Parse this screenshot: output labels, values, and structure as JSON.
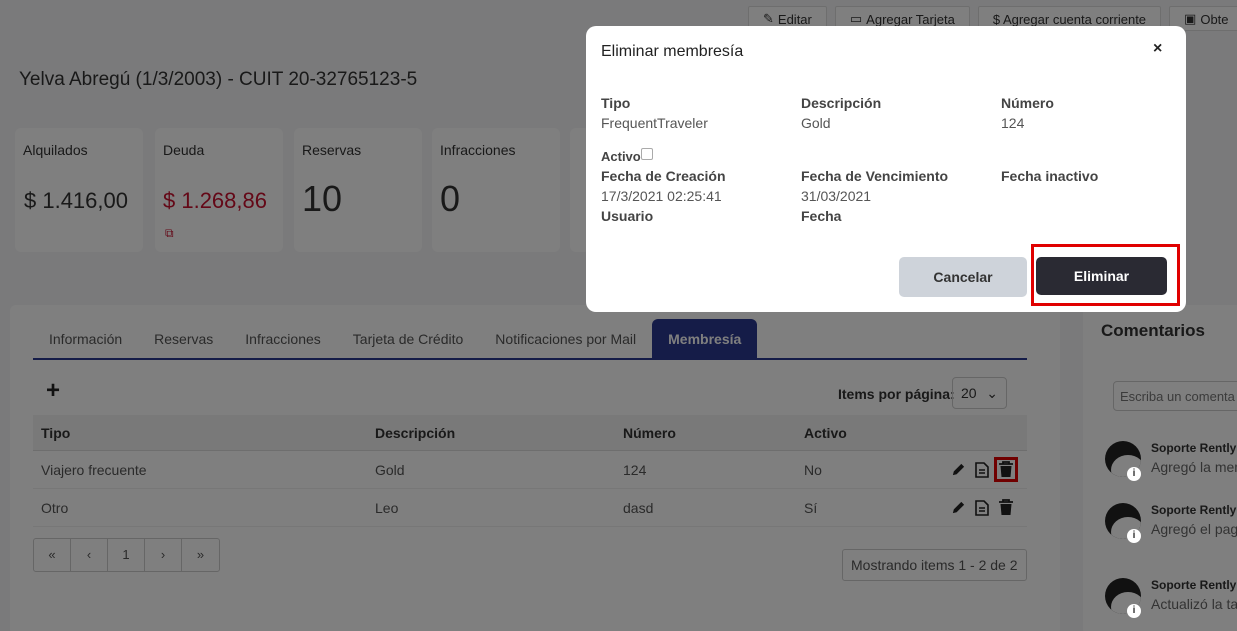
{
  "top_actions": [
    {
      "icon": "pencil-icon",
      "label": "Editar"
    },
    {
      "icon": "credit-card-icon",
      "label": "Agregar Tarjeta"
    },
    {
      "icon": "dollar-icon",
      "label": "$ Agregar cuenta corriente"
    },
    {
      "icon": "id-card-icon",
      "label": "Obte"
    }
  ],
  "client": {
    "title": "Yelva Abregú (1/3/2003) - CUIT 20-32765123-5"
  },
  "stats": [
    {
      "label": "Alquilados",
      "value": "$ 1.416,00"
    },
    {
      "label": "Deuda",
      "value": "$ 1.268,86"
    },
    {
      "label": "Reservas",
      "value": "10"
    },
    {
      "label": "Infracciones",
      "value": "0"
    }
  ],
  "tabs": [
    {
      "label": "Información"
    },
    {
      "label": "Reservas"
    },
    {
      "label": "Infracciones"
    },
    {
      "label": "Tarjeta de Crédito"
    },
    {
      "label": "Notificaciones por Mail"
    },
    {
      "label": "Membresía",
      "active": true
    }
  ],
  "table": {
    "add_label": "+",
    "per_page_label": "Items por página:",
    "per_page_value": "20",
    "headers": [
      "Tipo",
      "Descripción",
      "Número",
      "Activo"
    ],
    "rows": [
      [
        "Viajero frecuente",
        "Gold",
        "124",
        "No"
      ],
      [
        "Otro",
        "Leo",
        "dasd",
        "Sí"
      ]
    ],
    "pager": [
      "«",
      "‹",
      "1",
      "›",
      "»"
    ],
    "showing": "Mostrando items 1 - 2 de 2"
  },
  "comments": {
    "title": "Comentarios",
    "input_placeholder": "Escriba un comenta",
    "items": [
      {
        "author": "Soporte Rently -",
        "text": "Agregó la mem"
      },
      {
        "author": "Soporte Rently -",
        "text": "Agregó el pag"
      },
      {
        "author": "Soporte Rently -",
        "text": "Actualizó la ta"
      }
    ]
  },
  "modal": {
    "title": "Eliminar membresía",
    "close": "×",
    "tipo_label": "Tipo",
    "tipo_value": "FrequentTraveler",
    "descripcion_label": "Descripción",
    "descripcion_value": "Gold",
    "numero_label": "Número",
    "numero_value": "124",
    "activo_label": "Activo",
    "activo_checked": false,
    "creacion_label": "Fecha de Creación",
    "creacion_value": "17/3/2021 02:25:41",
    "vencimiento_label": "Fecha de Vencimiento",
    "vencimiento_value": "31/03/2021",
    "inactivo_label": "Fecha inactivo",
    "usuario_label": "Usuario",
    "fecha_label": "Fecha",
    "cancel_label": "Cancelar",
    "delete_label": "Eliminar"
  },
  "colors": {
    "accent": "#2b3990",
    "danger": "#c8102e",
    "highlight": "#e00000"
  }
}
